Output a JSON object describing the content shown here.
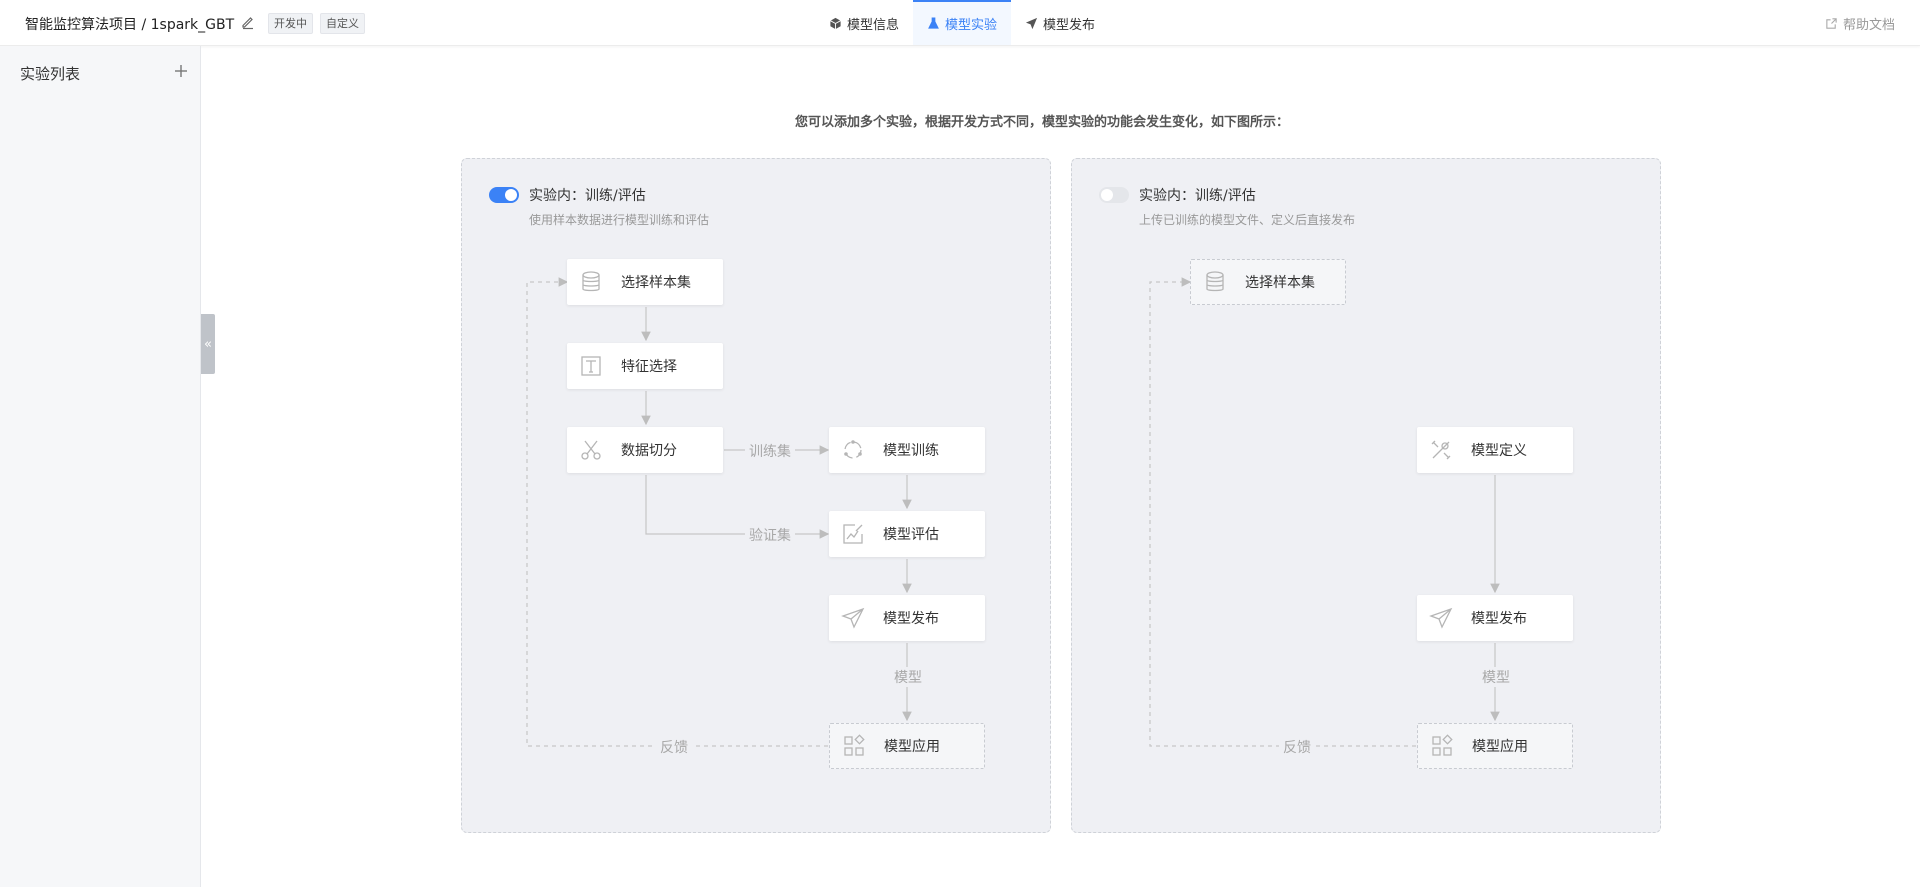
{
  "header": {
    "project_title": "智能监控算法项目 / 1spark_GBT",
    "tags": [
      "开发中",
      "自定义"
    ],
    "tabs": [
      {
        "label": "模型信息",
        "icon": "cube-icon"
      },
      {
        "label": "模型实验",
        "icon": "flask-icon",
        "active": true
      },
      {
        "label": "模型发布",
        "icon": "send-icon"
      }
    ],
    "help_label": "帮助文档",
    "accent_color": "#3b82f6"
  },
  "sidebar": {
    "title": "实验列表",
    "collapse_glyph": "«"
  },
  "main": {
    "intro": "您可以添加多个实验，根据开发方式不同，模型实验的功能会发生变化，如下图所示：",
    "panels": [
      {
        "toggle_on": true,
        "title": "实验内：训练/评估",
        "desc": "使用样本数据进行模型训练和评估",
        "nodes": {
          "select": "选择样本集",
          "feature": "特征选择",
          "split": "数据切分",
          "train": "模型训练",
          "eval": "模型评估",
          "publish": "模型发布",
          "apply": "模型应用"
        },
        "edge_labels": {
          "train_set": "训练集",
          "valid_set": "验证集",
          "model": "模型",
          "feedback": "反馈"
        }
      },
      {
        "toggle_on": false,
        "title": "实验内：训练/评估",
        "desc": "上传已训练的模型文件、定义后直接发布",
        "nodes": {
          "select": "选择样本集",
          "define": "模型定义",
          "publish": "模型发布",
          "apply": "模型应用"
        },
        "edge_labels": {
          "model": "模型",
          "feedback": "反馈"
        }
      }
    ]
  }
}
